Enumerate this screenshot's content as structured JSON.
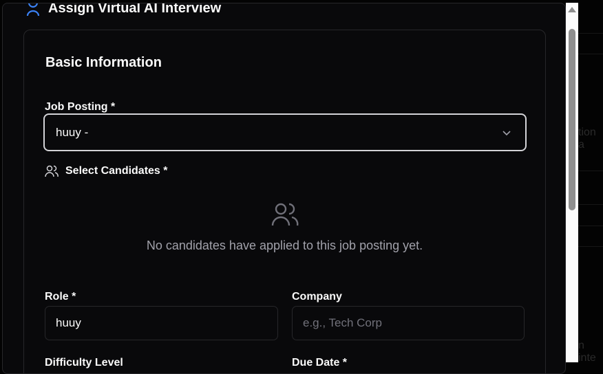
{
  "dialog": {
    "title": "Assign Virtual AI Interview"
  },
  "section": {
    "title": "Basic Information"
  },
  "job_posting": {
    "label": "Job Posting *",
    "value": "huuy -"
  },
  "candidates": {
    "label": "Select Candidates *",
    "empty_message": "No candidates have applied to this job posting yet."
  },
  "role": {
    "label": "Role *",
    "value": "huuy"
  },
  "company": {
    "label": "Company",
    "placeholder": "e.g., Tech Corp",
    "value": ""
  },
  "difficulty": {
    "label": "Difficulty Level"
  },
  "due_date": {
    "label": "Due Date *"
  },
  "background": {
    "text1": "tion a",
    "text2": "n inte"
  },
  "colors": {
    "accent": "#3b82f6",
    "background": "#09090b",
    "border": "#27272a"
  }
}
